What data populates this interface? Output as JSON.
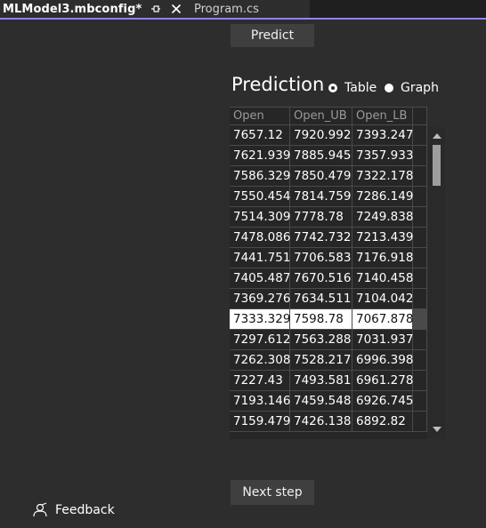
{
  "tabs": [
    {
      "title": "MLModel3.mbconfig*",
      "active": true
    },
    {
      "title": "Program.cs",
      "active": false
    }
  ],
  "colors": {
    "accent": "#9184ee",
    "background": "#2d2d2d",
    "tab_strip": "#1f1f1f"
  },
  "icons": {
    "pin": "pin-icon",
    "close": "close-icon",
    "feedback": "feedback-icon",
    "scroll_up": "chevron-up-icon",
    "scroll_down": "chevron-down-icon"
  },
  "predict_button": "Predict",
  "prediction": {
    "title": "Prediction",
    "view_options": [
      {
        "label": "Table",
        "checked": true
      },
      {
        "label": "Graph",
        "checked": false
      }
    ]
  },
  "grid": {
    "columns": [
      "Open",
      "Open_UB",
      "Open_LB"
    ],
    "rows": [
      [
        "7657.12",
        "7920.992",
        "7393.247"
      ],
      [
        "7621.939",
        "7885.945",
        "7357.933"
      ],
      [
        "7586.329",
        "7850.479",
        "7322.178"
      ],
      [
        "7550.454",
        "7814.759",
        "7286.149"
      ],
      [
        "7514.309",
        "7778.78",
        "7249.838"
      ],
      [
        "7478.086",
        "7742.732",
        "7213.439"
      ],
      [
        "7441.751",
        "7706.583",
        "7176.918"
      ],
      [
        "7405.487",
        "7670.516",
        "7140.458"
      ],
      [
        "7369.276",
        "7634.511",
        "7104.042"
      ],
      [
        "7333.329",
        "7598.78",
        "7067.878"
      ],
      [
        "7297.612",
        "7563.288",
        "7031.937"
      ],
      [
        "7262.308",
        "7528.217",
        "6996.398"
      ],
      [
        "7227.43",
        "7493.581",
        "6961.278"
      ],
      [
        "7193.146",
        "7459.548",
        "6926.745"
      ],
      [
        "7159.479",
        "7426.138",
        "6892.82"
      ]
    ],
    "selected_row": 9
  },
  "next_step_button": "Next step",
  "feedback_label": "Feedback"
}
